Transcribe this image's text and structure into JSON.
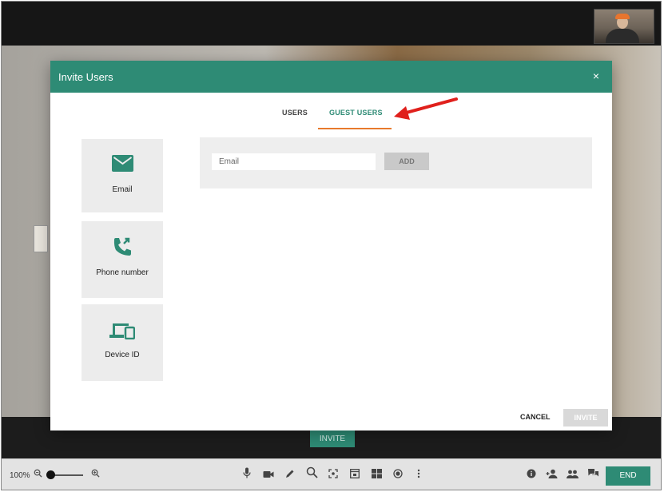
{
  "modal": {
    "title": "Invite Users",
    "close_icon": "×",
    "tabs": [
      {
        "label": "USERS",
        "active": false
      },
      {
        "label": "GUEST USERS",
        "active": true
      }
    ],
    "side_options": [
      {
        "label": "Email",
        "icon": "email-icon"
      },
      {
        "label": "Phone number",
        "icon": "phone-forward-icon"
      },
      {
        "label": "Device ID",
        "icon": "devices-icon"
      }
    ],
    "email_placeholder": "Email",
    "add_label": "ADD",
    "cancel_label": "CANCEL",
    "invite_label": "INVITE"
  },
  "background": {
    "invite_label": "INVITE"
  },
  "toolbar": {
    "zoom_level": "100%",
    "icons": [
      "zoom-out-icon",
      "zoom-in-icon",
      "microphone-icon",
      "video-camera-icon",
      "pen-icon",
      "magnify-icon",
      "screenshot-icon",
      "picture-in-picture-icon",
      "grid-layout-icon",
      "record-icon",
      "more-icon",
      "info-icon",
      "add-person-icon",
      "participants-icon",
      "chat-icon"
    ],
    "end_label": "END"
  },
  "colors": {
    "accent": "#2e8b75",
    "tab_underline": "#e87a2c",
    "arrow": "#e0201c"
  }
}
